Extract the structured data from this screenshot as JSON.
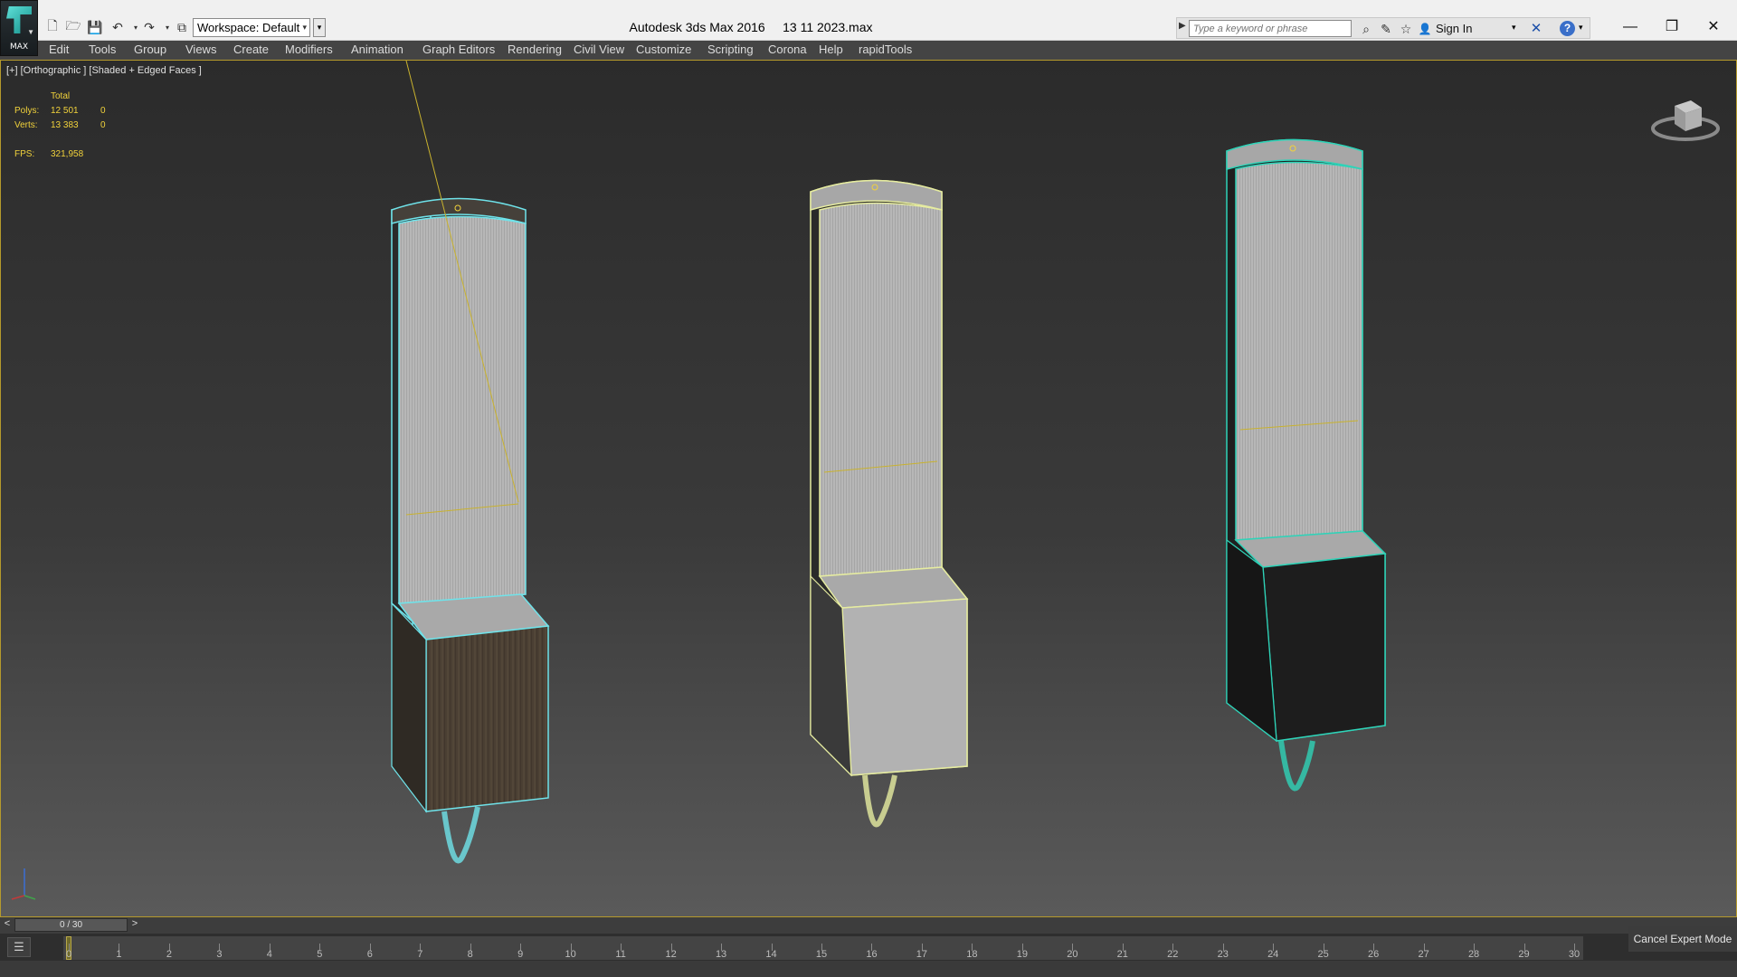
{
  "app": {
    "logo_caption": "MAX",
    "window_title": "Autodesk 3ds Max 2016     13 11 2023.max"
  },
  "toolbar": {
    "workspace": "Workspace: Default"
  },
  "search": {
    "placeholder": "Type a keyword or phrase",
    "sign_in": "Sign In"
  },
  "menu": {
    "items": [
      "Edit",
      "Tools",
      "Group",
      "Views",
      "Create",
      "Modifiers",
      "Animation",
      "Graph Editors",
      "Rendering",
      "Civil View",
      "Customize",
      "Scripting",
      "Corona",
      "Help",
      "rapidTools"
    ]
  },
  "viewport": {
    "label": "[+] [Orthographic ] [Shaded + Edged Faces ]",
    "stats": {
      "total_label": "Total",
      "polys_label": "Polys:",
      "polys_total": "12 501",
      "polys_sel": "0",
      "verts_label": "Verts:",
      "verts_total": "13 383",
      "verts_sel": "0",
      "fps_label": "FPS:",
      "fps_value": "321,958"
    }
  },
  "timeline": {
    "frame_display": "0 / 30",
    "prev": "<",
    "next": ">",
    "ticks": [
      0,
      1,
      2,
      3,
      4,
      5,
      6,
      7,
      8,
      9,
      10,
      11,
      12,
      13,
      14,
      15,
      16,
      17,
      18,
      19,
      20,
      21,
      22,
      23,
      24,
      25,
      26,
      27,
      28,
      29,
      30
    ],
    "current_frame": 0
  },
  "status": {
    "expert_mode": "Cancel Expert Mode"
  },
  "colors": {
    "selection_cyan": "#6fe3ea",
    "selection_yellow": "#e6eca0",
    "selection_teal": "#2fd3b8",
    "stats_yellow": "#f1d23b"
  }
}
